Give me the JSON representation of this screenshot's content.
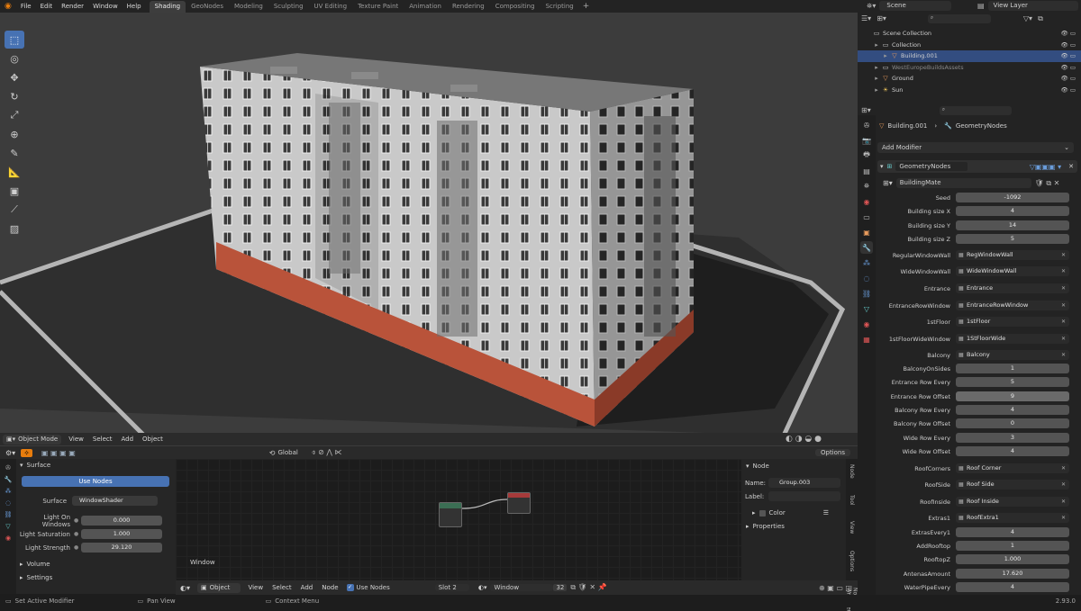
{
  "menu": [
    "File",
    "Edit",
    "Render",
    "Window",
    "Help"
  ],
  "workspaces": [
    {
      "label": "Shading",
      "active": true
    },
    {
      "label": "GeoNodes",
      "active": false
    },
    {
      "label": "Modeling",
      "active": false
    },
    {
      "label": "Sculpting",
      "active": false
    },
    {
      "label": "UV Editing",
      "active": false
    },
    {
      "label": "Texture Paint",
      "active": false
    },
    {
      "label": "Animation",
      "active": false
    },
    {
      "label": "Rendering",
      "active": false
    },
    {
      "label": "Compositing",
      "active": false
    },
    {
      "label": "Scripting",
      "active": false
    }
  ],
  "scene": {
    "name": "Scene",
    "view_layer": "View Layer"
  },
  "viewport_header": {
    "mode": "Object Mode",
    "menus": [
      "View",
      "Select",
      "Add",
      "Object"
    ]
  },
  "viewport_toolbar": {
    "orientation": "Global",
    "options_label": "Options"
  },
  "outliner": {
    "rows": [
      {
        "label": "Scene Collection",
        "indent": 0,
        "icon": "collection-icon"
      },
      {
        "label": "Collection",
        "indent": 1,
        "icon": "collection-icon"
      },
      {
        "label": "Building.001",
        "indent": 2,
        "icon": "mesh-icon",
        "selected": true
      },
      {
        "label": "WestEuropeBuildsAssets",
        "indent": 1,
        "icon": "collection-icon",
        "dim": true
      },
      {
        "label": "Ground",
        "indent": 1,
        "icon": "mesh-icon"
      },
      {
        "label": "Sun",
        "indent": 1,
        "icon": "light-icon"
      }
    ]
  },
  "properties": {
    "breadcrumb_object": "Building.001",
    "breadcrumb_modifier": "GeometryNodes",
    "add_modifier": "Add Modifier",
    "modifier_name": "GeometryNodes",
    "node_group": "BuildingMate",
    "params": [
      {
        "label": "Seed",
        "value": "-1092",
        "type": "num"
      },
      {
        "label": "Building size X",
        "value": "4",
        "type": "num"
      },
      {
        "label": "Building size  Y",
        "value": "14",
        "type": "num"
      },
      {
        "label": "Building size  Z",
        "value": "5",
        "type": "num"
      },
      {
        "label": "RegularWindowWall",
        "value": "RegWindowWall",
        "type": "obj"
      },
      {
        "label": "WideWindowWall",
        "value": "WideWindowWall",
        "type": "obj"
      },
      {
        "label": "Entrance",
        "value": "Entrance",
        "type": "obj"
      },
      {
        "label": "EntranceRowWindow",
        "value": "EntranceRowWindow",
        "type": "obj"
      },
      {
        "label": "1stFloor",
        "value": "1stFloor",
        "type": "obj"
      },
      {
        "label": "1stFloorWideWindow",
        "value": "1StFloorWide",
        "type": "obj"
      },
      {
        "label": "Balcony",
        "value": "Balcony",
        "type": "obj"
      },
      {
        "label": "BalconyOnSides",
        "value": "1",
        "type": "num"
      },
      {
        "label": "Entrance Row Every",
        "value": "5",
        "type": "num"
      },
      {
        "label": "Entrance Row Offset",
        "value": "9",
        "type": "hot"
      },
      {
        "label": "Balcony Row Every",
        "value": "4",
        "type": "num"
      },
      {
        "label": "Balcony Row Offset",
        "value": "0",
        "type": "num"
      },
      {
        "label": "Wide Row Every",
        "value": "3",
        "type": "num"
      },
      {
        "label": "Wide Row Offset",
        "value": "4",
        "type": "num"
      },
      {
        "label": "RoofCorners",
        "value": "Roof Corner",
        "type": "obj"
      },
      {
        "label": "RoofSide",
        "value": "Roof Side",
        "type": "obj"
      },
      {
        "label": "RoofInside",
        "value": "Roof Inside",
        "type": "obj"
      },
      {
        "label": "Extras1",
        "value": "RoofExtra1",
        "type": "obj"
      },
      {
        "label": "ExtrasEvery1",
        "value": "4",
        "type": "num"
      },
      {
        "label": "AddRooftop",
        "value": "1",
        "type": "num"
      },
      {
        "label": "RooftopZ",
        "value": "1.000",
        "type": "num"
      },
      {
        "label": "AntenasAmount",
        "value": "17.620",
        "type": "num"
      },
      {
        "label": "WaterPipeEvery",
        "value": "4",
        "type": "num"
      }
    ]
  },
  "surface_panel": {
    "title": "Surface",
    "use_nodes": "Use Nodes",
    "surface_label": "Surface",
    "surface_value": "WindowShader",
    "inputs": [
      {
        "label": "Light On Windows",
        "value": "0.000"
      },
      {
        "label": "Light Saturation",
        "value": "1.000"
      },
      {
        "label": "Light Strength",
        "value": "29.120"
      }
    ],
    "volume": "Volume",
    "settings": "Settings"
  },
  "node_editor": {
    "frame_label": "Window",
    "header_menus": [
      "View",
      "Select",
      "Add",
      "Node"
    ],
    "object_label": "Object",
    "use_nodes": "Use Nodes",
    "slot": "Slot 2",
    "material": "Window",
    "users": "32"
  },
  "node_sidebar": {
    "section": "Node",
    "name_label": "Name:",
    "name_value": "Group.003",
    "label_label": "Label:",
    "color": "Color",
    "properties": "Properties",
    "tabs": [
      "Node",
      "Tool",
      "View",
      "Options",
      "Node Wrangler"
    ]
  },
  "status": {
    "left": "Set Active Modifier",
    "middle": "Pan View",
    "right": "Context Menu",
    "version": "2.93.0"
  }
}
